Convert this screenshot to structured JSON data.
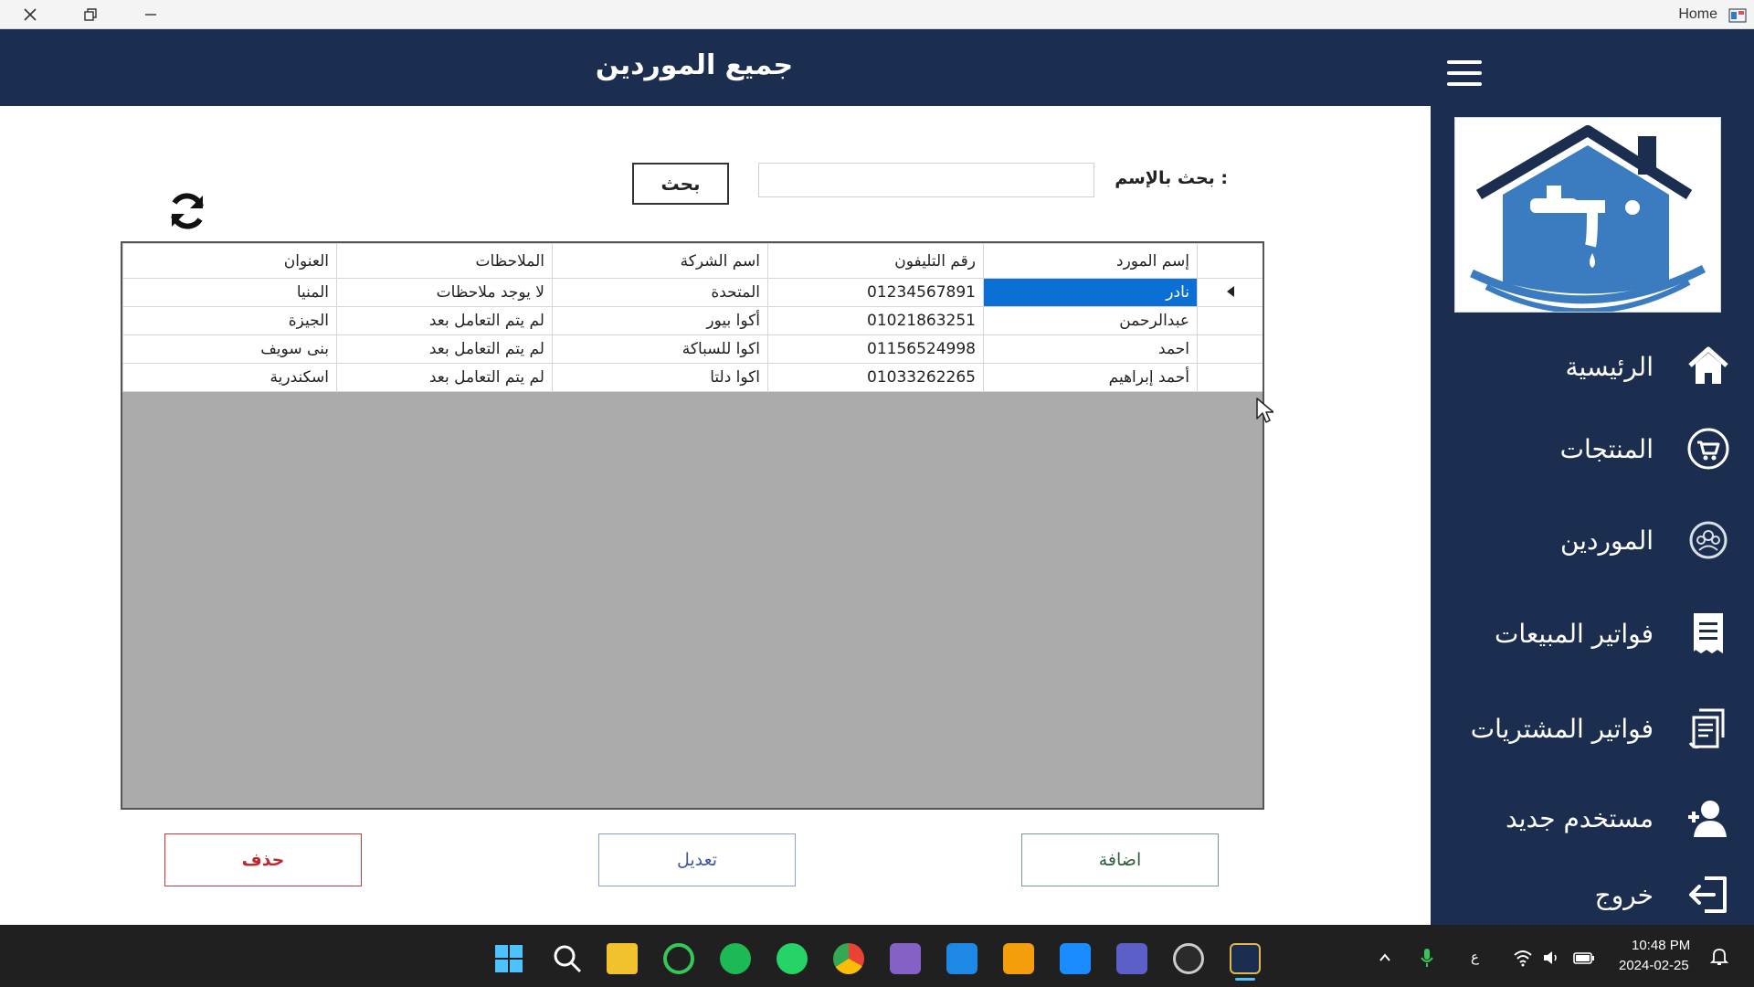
{
  "window": {
    "title": "Home"
  },
  "header": {
    "title": "جميع الموردين"
  },
  "sidebar": {
    "items": [
      {
        "label": "الرئيسية",
        "icon": "home-icon"
      },
      {
        "label": "المنتجات",
        "icon": "cart-icon"
      },
      {
        "label": "الموردين",
        "icon": "suppliers-icon"
      },
      {
        "label": "فواتير المبيعات",
        "icon": "receipt-icon"
      },
      {
        "label": "فواتير المشتريات",
        "icon": "invoice-icon"
      },
      {
        "label": "مستخدم جديد",
        "icon": "add-user-icon"
      },
      {
        "label": "خروج",
        "icon": "logout-icon"
      }
    ]
  },
  "search": {
    "label": "بحث بالإسم :",
    "value": "",
    "button_label": "بحث"
  },
  "table": {
    "columns": [
      "العنوان",
      "الملاحظات",
      "اسم الشركة",
      "رقم التليفون",
      "إسم المورد"
    ],
    "rows": [
      [
        "المنيا",
        "لا يوجد ملاحظات",
        "المتحدة",
        "01234567891",
        "نادر"
      ],
      [
        "الجيزة",
        "لم يتم التعامل بعد",
        "أكوا بيور",
        "01021863251",
        "عبدالرحمن"
      ],
      [
        "بنى سويف",
        "لم يتم التعامل بعد",
        "اكوا للسباكة",
        "01156524998",
        "احمد"
      ],
      [
        "اسكندرية",
        "لم يتم التعامل بعد",
        "اكوا دلتا",
        "01033262265",
        "أحمد إبراهيم"
      ]
    ]
  },
  "actions": {
    "add_label": "اضافة",
    "edit_label": "تعديل",
    "delete_label": "حذف"
  },
  "taskbar": {
    "time": "10:48 PM",
    "date": "2024-02-25",
    "input_lang": "ع"
  },
  "colors": {
    "brand": "#1c2e4f",
    "selection": "#0b6fd6",
    "delete": "#c0272d"
  }
}
